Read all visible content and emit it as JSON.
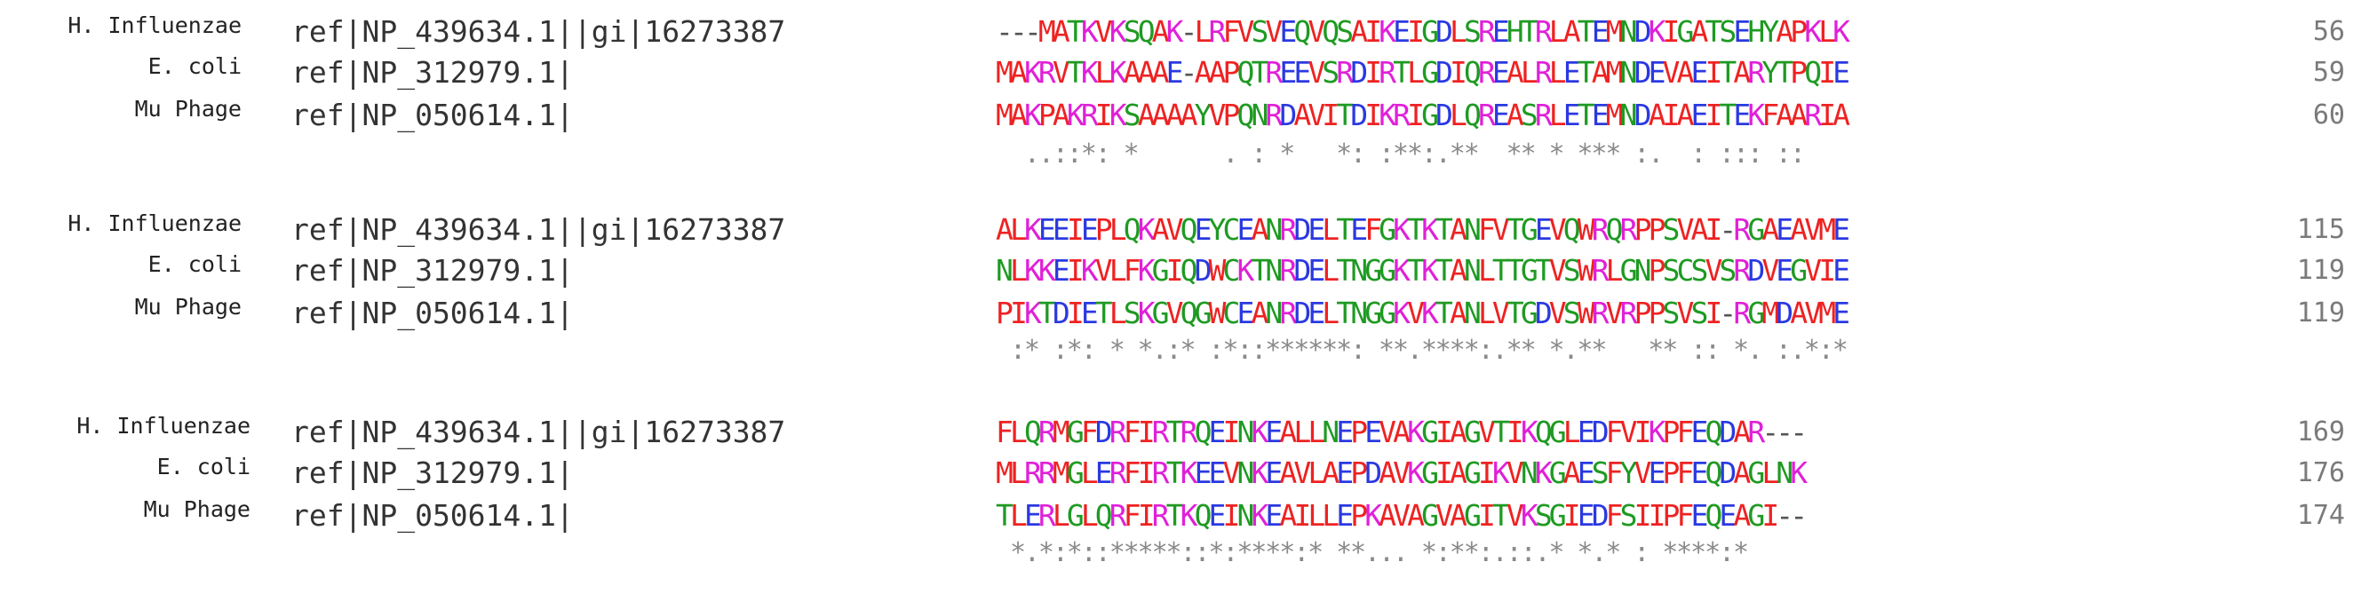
{
  "colors": {
    "small_hydrophobic": "#ee2222",
    "acidic": "#2a39e0",
    "basic": "#e020d8",
    "polar": "#1e9a22",
    "gap": "#555555",
    "position_number": "#7a7a7a",
    "conservation": "#8a8a8a"
  },
  "blocks": [
    {
      "rows": [
        {
          "organism": "H. Influenzae",
          "accession": "ref|NP_439634.1||gi|16273387",
          "sequence": "---MATKVKSQAK-LRFVSVEQVQSAIKEIGDLSREHTRLATEMNDKIGATSEHYAPKLK",
          "end": "56"
        },
        {
          "organism": "E. coli",
          "accession": "ref|NP_312979.1|",
          "sequence": "MAKRVTKLKAAAE-AAPQTREEVSRDIRTLGDIQREALRLETAMNDEVAEITARYTPQIE",
          "end": "59"
        },
        {
          "organism": "Mu Phage",
          "accession": "ref|NP_050614.1|",
          "sequence": "MAKPAKRIKSAAAAYVPQNRDAVITDIKRIGDLQREASRLETEMNDAIAEITEKFAARIA",
          "end": "60"
        }
      ],
      "conservation": "  ..::*: *      . : *   *: :**:.**  ** * *** :.  : ::: ::"
    },
    {
      "rows": [
        {
          "organism": "H. Influenzae",
          "accession": "ref|NP_439634.1||gi|16273387",
          "sequence": "ALKEEIEPLQKAVQEYCEANRDELTEFGKTKTANFVTGEVQWRQRPPSVAI-RGAEAVME",
          "end": "115"
        },
        {
          "organism": "E. coli",
          "accession": "ref|NP_312979.1|",
          "sequence": "NLKKEIKVLFKGIQDWCKTNRDELTNGGKTKTANLTTGTVSWRLGNPSCSVSRDVEGVIE",
          "end": "119"
        },
        {
          "organism": "Mu Phage",
          "accession": "ref|NP_050614.1|",
          "sequence": "PIKTDIETLSKGVQGWCEANRDELTNGGKVKTANLVTGDVSWRVRPPSVSI-RGMDAVME",
          "end": "119"
        }
      ],
      "conservation": " :* :*: * *.:* :*::******: **.****:.** *.**   ** :: *. :.*:*"
    },
    {
      "rows": [
        {
          "organism": "H. Influenzae",
          "accession": "ref|NP_439634.1||gi|16273387",
          "sequence": "FLQRMGFDRFIRTRQEINKEALLNEPEVAKGIAGVTIKQGLEDFVIKPFEQDAR---",
          "end": "169"
        },
        {
          "organism": "E. coli",
          "accession": "ref|NP_312979.1|",
          "sequence": "MLRRMGLERFIRTKEEVNKEAVLAEPDAVKGIAGIKVNKGAESFYVEPFEQDAGLNK",
          "end": "176"
        },
        {
          "organism": "Mu Phage",
          "accession": "ref|NP_050614.1|",
          "sequence": "TLERLGLQRFIRTKQEINKEAILLEPKAVAGVAGITVKSGIEDFSIIPFEQEAGI--",
          "end": "174"
        }
      ],
      "conservation": " *.*:*::*****::*:****:* **... *:**:.::.* *.* : ****:*"
    }
  ]
}
